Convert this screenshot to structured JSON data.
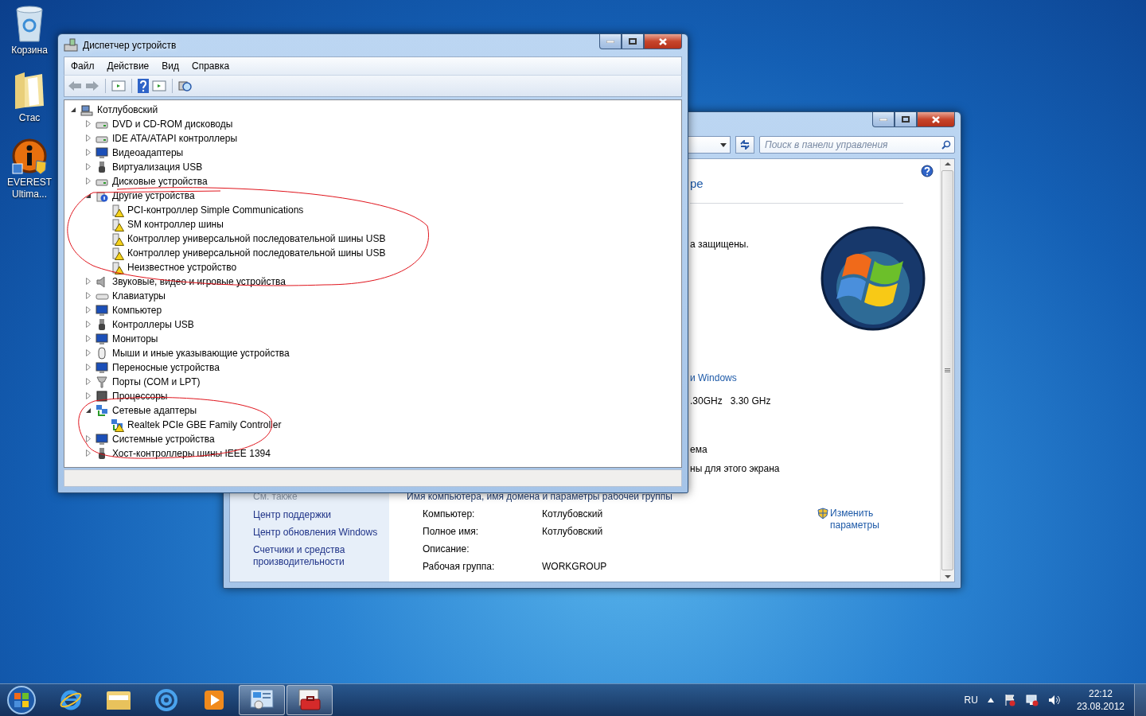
{
  "desktop_icons": [
    {
      "label": "Корзина",
      "kind": "recycle"
    },
    {
      "label": "Стас",
      "kind": "folder"
    },
    {
      "label": "EVEREST Ultima...",
      "kind": "app"
    }
  ],
  "control_panel": {
    "search": {
      "placeholder": "Поиск в панели управления"
    },
    "heading": "ре",
    "main_texts": [
      {
        "text": "а защищены.",
        "kind": "text"
      },
      {
        "text": "и Windows",
        "kind": "link"
      },
      {
        "text": ".30GHz",
        "kind": "pair",
        "value": "3.30 GHz"
      },
      {
        "text": "ема",
        "kind": "text"
      },
      {
        "text": "ны для этого экрана",
        "kind": "text"
      }
    ],
    "see_also": {
      "title": "См. также",
      "links": [
        "Центр поддержки",
        "Центр обновления Windows",
        "Счетчики и средства производительности"
      ]
    },
    "section_title": "Имя компьютера, имя домена и параметры рабочей группы",
    "info_rows": [
      {
        "label": "Компьютер:",
        "value": "Котлубовский"
      },
      {
        "label": "Полное имя:",
        "value": "Котлубовский"
      },
      {
        "label": "Описание:"
      },
      {
        "label": "Рабочая группа:",
        "value": "WORKGROUP"
      }
    ],
    "change_link": "Изменить параметры"
  },
  "device_manager": {
    "title": "Диспетчер устройств",
    "menu": [
      "Файл",
      "Действие",
      "Вид",
      "Справка"
    ],
    "tree": {
      "label": "Котлубовский",
      "kind": "computer",
      "expanded": true,
      "children": [
        {
          "label": "DVD и CD-ROM дисководы",
          "kind": "drive",
          "expanded": false
        },
        {
          "label": "IDE ATA/ATAPI контроллеры",
          "kind": "drive",
          "expanded": false
        },
        {
          "label": "Видеоадаптеры",
          "kind": "monitor",
          "expanded": false
        },
        {
          "label": "Виртуализация USB",
          "kind": "usb",
          "expanded": false
        },
        {
          "label": "Дисковые устройства",
          "kind": "drive",
          "expanded": false
        },
        {
          "label": "Другие устройства",
          "kind": "unknown",
          "expanded": true,
          "children": [
            {
              "label": "PCI-контроллер Simple Communications",
              "kind": "device",
              "warning": true
            },
            {
              "label": "SM контроллер шины",
              "kind": "device",
              "warning": true
            },
            {
              "label": "Контроллер универсальной последовательной шины USB",
              "kind": "device",
              "warning": true
            },
            {
              "label": "Контроллер универсальной последовательной шины USB",
              "kind": "device",
              "warning": true
            },
            {
              "label": "Неизвестное устройство",
              "kind": "device",
              "warning": true
            }
          ]
        },
        {
          "label": "Звуковые, видео и игровые устройства",
          "kind": "speaker",
          "expanded": false
        },
        {
          "label": "Клавиатуры",
          "kind": "keyboard",
          "expanded": false
        },
        {
          "label": "Компьютер",
          "kind": "monitor",
          "expanded": false
        },
        {
          "label": "Контроллеры USB",
          "kind": "usb",
          "expanded": false
        },
        {
          "label": "Мониторы",
          "kind": "monitor",
          "expanded": false
        },
        {
          "label": "Мыши и иные указывающие устройства",
          "kind": "mouse",
          "expanded": false
        },
        {
          "label": "Переносные устройства",
          "kind": "monitor",
          "expanded": false
        },
        {
          "label": "Порты (COM и LPT)",
          "kind": "port",
          "expanded": false
        },
        {
          "label": "Процессоры",
          "kind": "chip",
          "expanded": false
        },
        {
          "label": "Сетевые адаптеры",
          "kind": "network",
          "expanded": true,
          "children": [
            {
              "label": "Realtek PCIe GBE Family Controller",
              "kind": "network",
              "warning": true
            }
          ]
        },
        {
          "label": "Системные устройства",
          "kind": "monitor",
          "expanded": false
        },
        {
          "label": "Хост-контроллеры шины IEEE 1394",
          "kind": "usb",
          "expanded": false
        }
      ]
    }
  },
  "taskbar": {
    "buttons": [
      {
        "kind": "ie",
        "open": false
      },
      {
        "kind": "explorer",
        "open": false
      },
      {
        "kind": "mail",
        "open": false
      },
      {
        "kind": "media",
        "open": false
      },
      {
        "kind": "control-panel",
        "open": true
      },
      {
        "kind": "toolbox",
        "open": true
      }
    ],
    "language": "RU",
    "time": "22:12",
    "date": "23.08.2012"
  }
}
